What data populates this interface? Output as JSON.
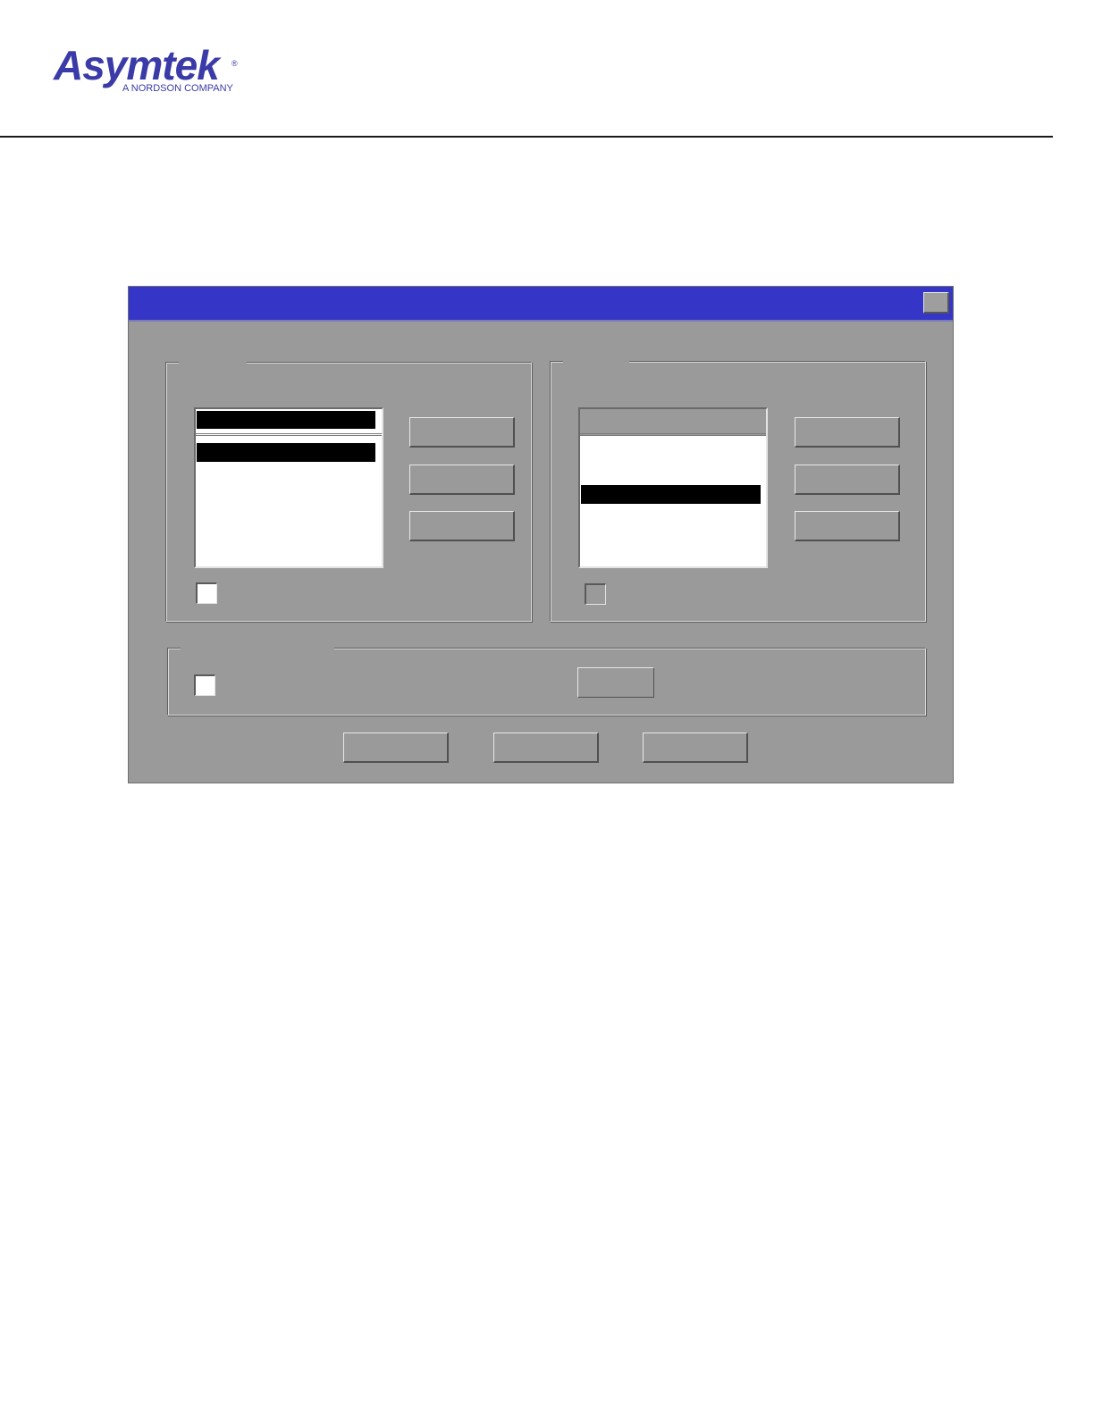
{
  "header": {
    "logo": {
      "brand": "Asymtek",
      "registered": "®",
      "tagline": "A NORDSON COMPANY",
      "color": "#3a3aa8"
    }
  },
  "dialog": {
    "title_bar_color": "#3535c8",
    "background_color": "#9a9a9a",
    "close_icon": "close-icon",
    "left_group": {
      "list_header_selected": true,
      "selected_row": 0,
      "checkbox_checked": false,
      "checkbox_enabled": true
    },
    "right_group": {
      "list_header_selected": false,
      "selected_row": 2,
      "checkbox_checked": false,
      "checkbox_enabled": false
    },
    "bottom_group": {
      "checkbox_checked": false,
      "checkbox_enabled": true
    }
  }
}
